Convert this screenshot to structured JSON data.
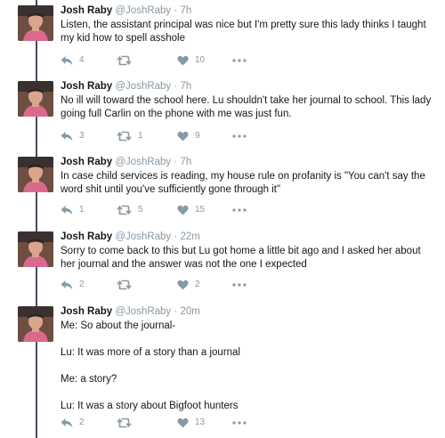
{
  "tweets": [
    {
      "name": "Josh Raby",
      "handle": "@JoshRaby",
      "sep": "·",
      "time": "7h",
      "lines": [
        "Listen, the assistant principal was nice but I'm pretty sure this lady thinks I taught my kid how to spell asshole"
      ],
      "replies": "4",
      "retweets": "",
      "likes": "10"
    },
    {
      "name": "Josh Raby",
      "handle": "@JoshRaby",
      "sep": "·",
      "time": "7h",
      "lines": [
        "No ill will toward the school here. Lu shouldn't take her journal to school. This lady going full Carlin on the phone with me was just fun."
      ],
      "replies": "3",
      "retweets": "1",
      "likes": "9"
    },
    {
      "name": "Josh Raby",
      "handle": "@JoshRaby",
      "sep": "·",
      "time": "7h",
      "lines": [
        "In case child services is reading, my house rule on profanity is \"You can't say the word shit until you've sufficiently gone through it\""
      ],
      "replies": "1",
      "retweets": "5",
      "likes": "15"
    },
    {
      "name": "Josh Raby",
      "handle": "@JoshRaby",
      "sep": "·",
      "time": "22m",
      "lines": [
        "Sorry to come back to this but Lu got home a little bit ago and I asked her about her journal and the answer was not the one I expected"
      ],
      "replies": "2",
      "retweets": "",
      "likes": "2"
    },
    {
      "name": "Josh Raby",
      "handle": "@JoshRaby",
      "sep": "·",
      "time": "20m",
      "lines": [
        "Me: So about the journal-",
        "Lu: It was more of a story than a journal",
        "Me: a story?",
        "Lu: It was a story about Bigfoot hunters"
      ],
      "replies": "2",
      "retweets": "",
      "likes": "13"
    }
  ],
  "icons": {
    "reply": "reply-icon",
    "retweet": "retweet-icon",
    "like": "heart-icon",
    "more": "more-icon"
  },
  "colors": {
    "muted": "#8899a6",
    "text": "#14171a",
    "thread_line": "#4a4a5e"
  }
}
